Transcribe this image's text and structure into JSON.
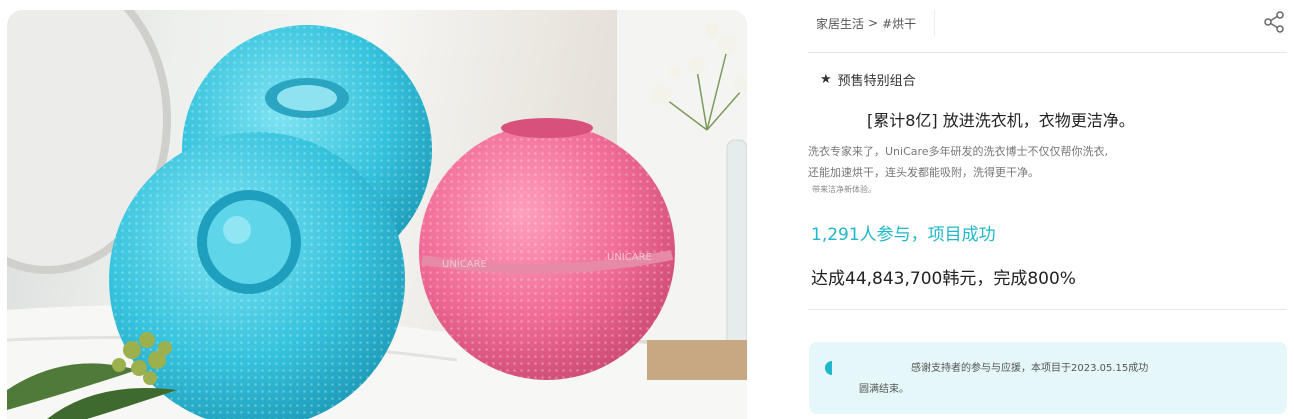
{
  "product": {
    "image_alt": "Blue and pink silicone laundry balls",
    "ball_text_left": "UNICARE",
    "ball_text_right": "UNICARE"
  },
  "breadcrumb": {
    "category": "家居生活",
    "separator": ">",
    "subcategory": "#烘干"
  },
  "share": {
    "icon": "share-icon"
  },
  "tag": {
    "icon": "★",
    "label": "预售特别组合"
  },
  "headline": "[累计8亿] 放进洗衣机，衣物更洁净。",
  "description": {
    "line1": "洗衣专家来了，UniCare多年研发的洗衣博士不仅仅帮你洗衣,",
    "line2": "还能加速烘干，连头发都能吸附，洗得更干净。",
    "line3": "带来洁净新体验。"
  },
  "stats": {
    "participants": "1,291人参与，项目成功",
    "achieved": "达成44,843,700韩元，完成800%"
  },
  "notice": {
    "line1": "感谢支持者的参与与应援，本项目于2023.05.15成功",
    "line2": "圆满结束。"
  },
  "colors": {
    "accent": "#1fb8c8",
    "notice_bg": "#e5f7f9",
    "ball_blue": "#3ec8e0",
    "ball_pink": "#f06a96"
  }
}
